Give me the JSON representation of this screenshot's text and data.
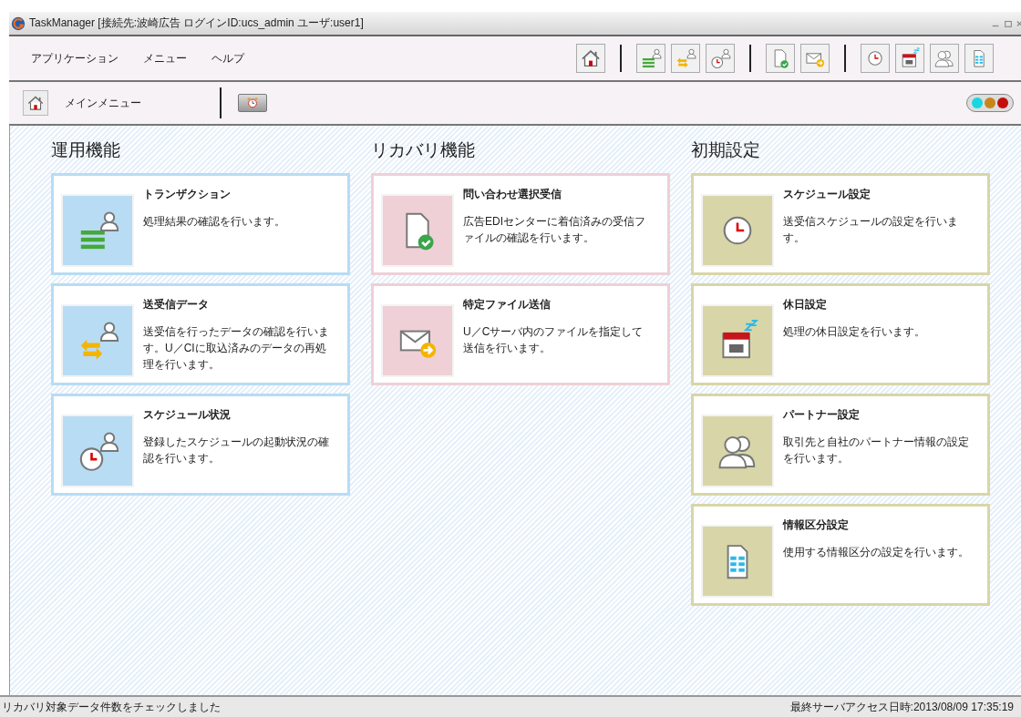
{
  "window": {
    "title": "TaskManager [接続先:波崎広告  ログインID:ucs_admin  ユーザ:user1]"
  },
  "menu_bar": {
    "items": [
      "アプリケーション",
      "メニュー",
      "ヘルプ"
    ]
  },
  "toolbar_groups": [
    [
      {
        "kind": "home"
      }
    ],
    [
      {
        "kind": "transaction"
      },
      {
        "kind": "transfer"
      },
      {
        "kind": "schedule"
      }
    ],
    [
      {
        "kind": "receive"
      },
      {
        "kind": "send"
      }
    ],
    [
      {
        "kind": "clock"
      },
      {
        "kind": "calendar"
      },
      {
        "kind": "partners"
      },
      {
        "kind": "sheet"
      }
    ]
  ],
  "nav_bar": {
    "label": "メインメニュー",
    "status_lights": [
      {
        "color": "#19d6e0"
      },
      {
        "color": "#c8861a"
      },
      {
        "color": "#c40d0d"
      }
    ]
  },
  "columns": [
    {
      "heading": "運用機能",
      "color": "#b8dcf4",
      "cards": [
        {
          "kind": "transaction",
          "title": "トランザクション",
          "description": "処理結果の確認を行います。"
        },
        {
          "kind": "transfer",
          "title": "送受信データ",
          "description": "送受信を行ったデータの確認を行います。U／CIに取込済みのデータの再処理を行います。"
        },
        {
          "kind": "schedule",
          "title": "スケジュール状況",
          "description": "登録したスケジュールの起動状況の確認を行います。"
        }
      ]
    },
    {
      "heading": "リカバリ機能",
      "color": "#efd0d6",
      "cards": [
        {
          "kind": "receive",
          "title": "問い合わせ選択受信",
          "description": "広告EDIセンターに着信済みの受信ファイルの確認を行います。"
        },
        {
          "kind": "send",
          "title": "特定ファイル送信",
          "description": "U／Cサーバ内のファイルを指定して送信を行います。"
        }
      ]
    },
    {
      "heading": "初期設定",
      "color": "#d8d6a8",
      "cards": [
        {
          "kind": "clock",
          "title": "スケジュール設定",
          "description": "送受信スケジュールの設定を行います。"
        },
        {
          "kind": "calendar",
          "title": "休日設定",
          "description": "処理の休日設定を行います。"
        },
        {
          "kind": "partners",
          "title": "パートナー設定",
          "description": "取引先と自社のパートナー情報の設定を行います。"
        },
        {
          "kind": "sheet",
          "title": "情報区分設定",
          "description": "使用する情報区分の設定を行います。"
        }
      ]
    }
  ],
  "status_bar": {
    "message": "リカバリ対象データ件数をチェックしました",
    "last_access": "最終サーバアクセス日時:2013/08/09 17:35:19"
  }
}
